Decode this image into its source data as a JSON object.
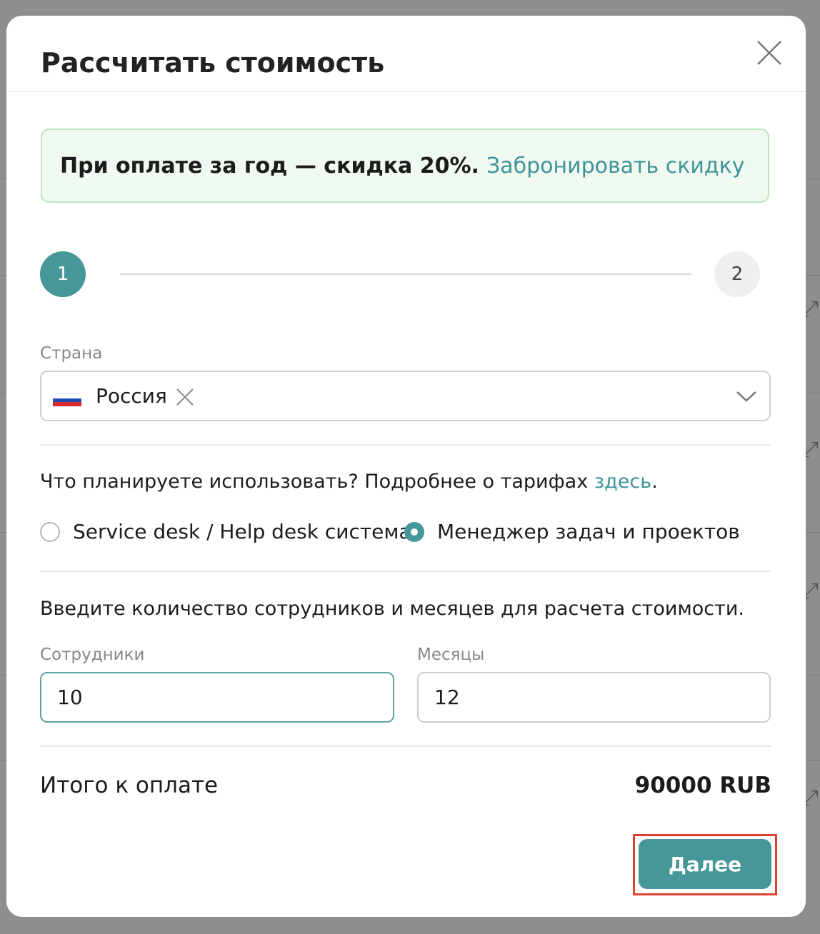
{
  "modal": {
    "title": "Рассчитать стоимость",
    "close_icon": "close-icon"
  },
  "promo": {
    "text": "При оплате за год — скидка 20%.",
    "link": "Забронировать скидку",
    "background": "#f0faf0",
    "border": "#b9e4bd"
  },
  "steps": {
    "current": 1,
    "items": [
      "1",
      "2"
    ]
  },
  "country": {
    "label": "Страна",
    "value": "Россия",
    "flag_icon": "russia-flag-icon",
    "clear_icon": "clear-x-icon",
    "dropdown_icon": "chevron-down-icon"
  },
  "usage": {
    "question": "Что планируете использовать? Подробнее о тарифах ",
    "link": "здесь",
    "question_end": ".",
    "options": [
      {
        "label": "Service desk / Help desk система",
        "selected": false
      },
      {
        "label": "Менеджер задач и проектов",
        "selected": true
      }
    ]
  },
  "calc": {
    "instruction": "Введите количество сотрудников и месяцев для расчета стоимости.",
    "employees_label": "Сотрудники",
    "employees_value": "10",
    "months_label": "Месяцы",
    "months_value": "12"
  },
  "total": {
    "label": "Итого к оплате",
    "value": "90000 RUB"
  },
  "actions": {
    "next_label": "Далее"
  },
  "colors": {
    "accent": "#45979a",
    "link": "#3f9499",
    "highlight_border": "#e0412f"
  }
}
